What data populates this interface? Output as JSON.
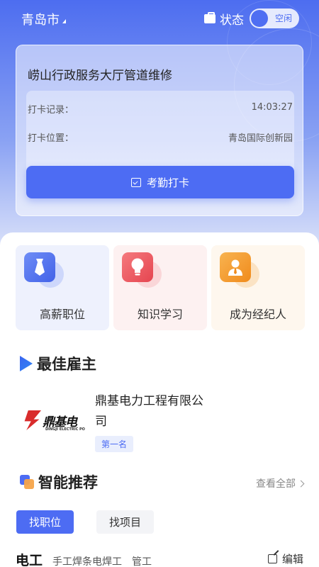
{
  "header": {
    "city": "青岛市",
    "status_label": "状态",
    "status_value": "空闲"
  },
  "attendance": {
    "project": "崂山行政服务大厅管道维修",
    "record_label": "打卡记录：",
    "record_time": "14:03:27",
    "location_label": "打卡位置：",
    "location_value": "青岛国际创新园",
    "punch_button": "考勤打卡"
  },
  "quick_tiles": [
    {
      "label": "高薪职位",
      "icon": "tie-icon"
    },
    {
      "label": "知识学习",
      "icon": "lightbulb-icon"
    },
    {
      "label": "成为经纪人",
      "icon": "agent-person-icon"
    }
  ],
  "best_employer": {
    "title": "最佳雇主",
    "logo_text": "鼎基电",
    "logo_subtext": "DINGJI ELECTRIC PO",
    "company_name": "鼎基电力工程有限公司",
    "rank_badge": "第一名"
  },
  "recommend": {
    "title": "智能推荐",
    "view_all": "查看全部",
    "tabs": [
      "找职位",
      "找项目"
    ],
    "categories": [
      "电工",
      "手工焊条电焊工",
      "管工"
    ],
    "edit_label": "编辑"
  },
  "colors": {
    "accent": "#4d6cf3",
    "red": "#e54550",
    "orange": "#f08b1c"
  }
}
